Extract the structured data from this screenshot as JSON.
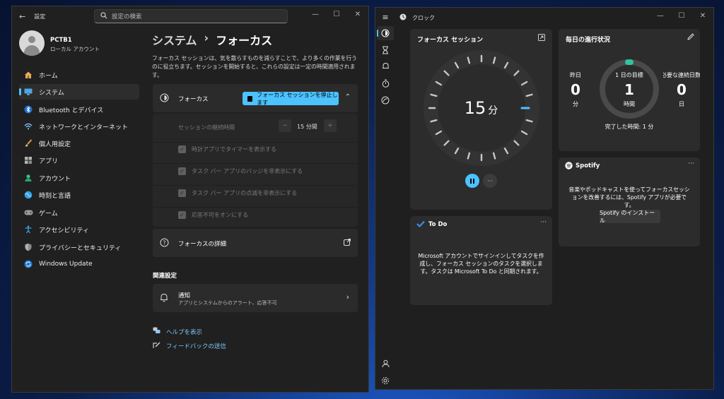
{
  "settings": {
    "title": "設定",
    "search_placeholder": "設定の検索",
    "account": {
      "name": "PCTB1",
      "type": "ローカル アカウント"
    },
    "nav": [
      {
        "label": "ホーム",
        "icon": "home-icon"
      },
      {
        "label": "システム",
        "icon": "system-icon",
        "active": true
      },
      {
        "label": "Bluetooth とデバイス",
        "icon": "bluetooth-icon"
      },
      {
        "label": "ネットワークとインターネット",
        "icon": "wifi-icon"
      },
      {
        "label": "個人用設定",
        "icon": "brush-icon"
      },
      {
        "label": "アプリ",
        "icon": "apps-icon"
      },
      {
        "label": "アカウント",
        "icon": "account-icon"
      },
      {
        "label": "時刻と言語",
        "icon": "globe-icon"
      },
      {
        "label": "ゲーム",
        "icon": "gamepad-icon"
      },
      {
        "label": "アクセシビリティ",
        "icon": "accessibility-icon"
      },
      {
        "label": "プライバシーとセキュリティ",
        "icon": "shield-icon"
      },
      {
        "label": "Windows Update",
        "icon": "update-icon"
      }
    ],
    "breadcrumb": {
      "parent": "システム",
      "sep": "›",
      "current": "フォーカス"
    },
    "description": "フォーカス セッションは、気を散らすものを減らすことで、より多くの作業を行うのに役立ちます。セッションを開始すると、これらの設定は一定の時間適用されます。",
    "focus": {
      "label": "フォーカス",
      "stop_button": "フォーカス セッションを停止します",
      "duration_label": "セッションの継続時間",
      "duration_value": "15 分間",
      "options": [
        "時計アプリでタイマーを表示する",
        "タスク バー アプリのバッジを非表示にする",
        "タスク バー アプリの点滅を非表示にする",
        "応答不可をオンにする"
      ]
    },
    "details_label": "フォーカスの詳細",
    "related_heading": "関連設定",
    "notifications": {
      "title": "通知",
      "subtitle": "アプリとシステムからのアラート、応答不可"
    },
    "help_link": "ヘルプを表示",
    "feedback_link": "フィードバックの送信"
  },
  "clock": {
    "title": "クロック",
    "focus_session": {
      "title": "フォーカス セッション",
      "minutes": "15",
      "unit": "分"
    },
    "daily_progress": {
      "title": "毎日の進行状況",
      "yesterday_label": "昨日",
      "yesterday_value": "0",
      "yesterday_unit": "分",
      "goal_label": "1 日の目標",
      "goal_value": "1",
      "goal_unit": "時間",
      "streak_label": "必要な連続日数",
      "streak_value": "0",
      "streak_unit": "日",
      "completed": "完了した時間: 1 分"
    },
    "spotify": {
      "title": "Spotify",
      "body": "音楽やポッドキャストを使ってフォーカスセッションを改善するには、Spotify アプリが必要です。",
      "button": "Spotify のインストール"
    },
    "todo": {
      "title": "To Do",
      "body": "Microsoft アカウントでサインインしてタスクを作成し、フォーカス セッションのタスクを選択します。タスクは Microsoft To Do と同期されます。"
    }
  },
  "colors": {
    "accent": "#4cc2ff",
    "progress": "#2ec5a0"
  }
}
